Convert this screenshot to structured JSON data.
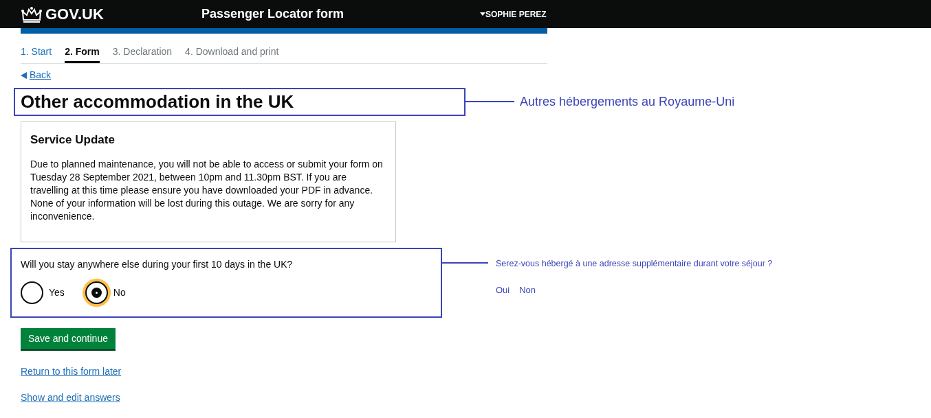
{
  "header": {
    "logo": "GOV.UK",
    "title": "Passenger Locator form",
    "user": "SOPHIE PEREZ"
  },
  "steps": [
    {
      "label": "1. Start",
      "selected": false,
      "kind": "done"
    },
    {
      "label": "2. Form",
      "selected": true,
      "kind": "current"
    },
    {
      "label": "3. Declaration",
      "selected": false,
      "kind": "todo"
    },
    {
      "label": "4. Download and print",
      "selected": false,
      "kind": "todo"
    }
  ],
  "back_link": "Back",
  "heading": "Other accommodation in the UK",
  "notice": {
    "title": "Service Update",
    "body": "Due to planned maintenance, you will not be able to access or submit your form on Tuesday 28 September 2021, between 10pm and 11.30pm BST. If you are travelling at this time please ensure you have downloaded your PDF in advance. None of your information will be lost during this outage. We are sorry for any inconvenience."
  },
  "question": {
    "label": "Will you stay anywhere else during your first 10 days in the UK?",
    "options": [
      {
        "label": "Yes",
        "selected": false
      },
      {
        "label": "No",
        "selected": true
      }
    ]
  },
  "button": "Save and continue",
  "links": [
    "Return to this form later",
    "Show and edit answers"
  ],
  "annotations": {
    "heading_translation": "Autres hébergements au Royaume-Uni",
    "question_translation": "Serez-vous hébergé à une adresse supplémentaire durant votre séjour ?",
    "option_translations": [
      "Oui",
      "Non"
    ]
  }
}
